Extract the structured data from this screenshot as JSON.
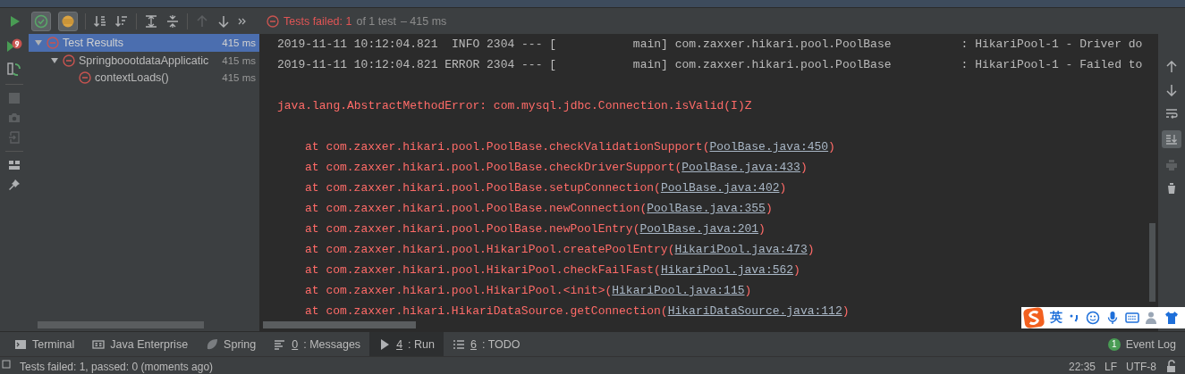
{
  "run_toolbar": {
    "toggles": [
      {
        "kind": "passed",
        "selected": true
      },
      {
        "kind": "ignored",
        "selected": true
      }
    ]
  },
  "status_header": {
    "failed": "Tests failed: 1",
    "rest": "of 1 test",
    "duration": "– 415 ms"
  },
  "tree": [
    {
      "label": "Test Results",
      "time": "415 ms",
      "expanded": true,
      "selected": true,
      "children": [
        {
          "label": "SpringboootdataApplicatic",
          "time": "415 ms",
          "expanded": true,
          "selected": false,
          "children": [
            {
              "label": "contextLoads()",
              "time": "415 ms",
              "selected": false
            }
          ]
        }
      ]
    }
  ],
  "console": {
    "lines": [
      {
        "kind": "log",
        "text": "2019-11-11 10:12:04.821  INFO 2304 --- [           main] com.zaxxer.hikari.pool.PoolBase          : HikariPool-1 - Driver do"
      },
      {
        "kind": "log",
        "text": "2019-11-11 10:12:04.821 ERROR 2304 --- [           main] com.zaxxer.hikari.pool.PoolBase          : HikariPool-1 - Failed to"
      },
      {
        "kind": "blank"
      },
      {
        "kind": "error",
        "text": "java.lang.AbstractMethodError: com.mysql.jdbc.Connection.isValid(I)Z"
      },
      {
        "kind": "blank"
      },
      {
        "kind": "frame",
        "call": "at com.zaxxer.hikari.pool.PoolBase.checkValidationSupport(",
        "link": "PoolBase.java:450",
        "close": ")"
      },
      {
        "kind": "frame",
        "call": "at com.zaxxer.hikari.pool.PoolBase.checkDriverSupport(",
        "link": "PoolBase.java:433",
        "close": ")"
      },
      {
        "kind": "frame",
        "call": "at com.zaxxer.hikari.pool.PoolBase.setupConnection(",
        "link": "PoolBase.java:402",
        "close": ")"
      },
      {
        "kind": "frame",
        "call": "at com.zaxxer.hikari.pool.PoolBase.newConnection(",
        "link": "PoolBase.java:355",
        "close": ")"
      },
      {
        "kind": "frame",
        "call": "at com.zaxxer.hikari.pool.PoolBase.newPoolEntry(",
        "link": "PoolBase.java:201",
        "close": ")"
      },
      {
        "kind": "frame",
        "call": "at com.zaxxer.hikari.pool.HikariPool.createPoolEntry(",
        "link": "HikariPool.java:473",
        "close": ")"
      },
      {
        "kind": "frame",
        "call": "at com.zaxxer.hikari.pool.HikariPool.checkFailFast(",
        "link": "HikariPool.java:562",
        "close": ")"
      },
      {
        "kind": "frame",
        "call": "at com.zaxxer.hikari.pool.HikariPool.<init>(",
        "link": "HikariPool.java:115",
        "close": ")"
      },
      {
        "kind": "frame",
        "call": "at com.zaxxer.hikari.HikariDataSource.getConnection(",
        "link": "HikariDataSource.java:112",
        "close": ")"
      }
    ]
  },
  "tool_windows": [
    {
      "kind": "terminal",
      "label": "Terminal",
      "selected": false
    },
    {
      "kind": "javaee",
      "label": "Java Enterprise",
      "selected": false
    },
    {
      "kind": "spring",
      "label": "Spring",
      "selected": false
    },
    {
      "kind": "messages",
      "mnemonic": "0",
      "label": ": Messages",
      "selected": false
    },
    {
      "kind": "run",
      "mnemonic": "4",
      "label": ": Run",
      "selected": true
    },
    {
      "kind": "todo",
      "mnemonic": "6",
      "label": ": TODO",
      "selected": false
    }
  ],
  "event_log": {
    "count": "1",
    "label": "Event Log"
  },
  "status_bar": {
    "message": "Tests failed: 1, passed: 0 (moments ago)",
    "position": "22:35",
    "line_separator": "LF",
    "encoding": "UTF-8"
  },
  "ime_bar": {
    "mode": "英"
  }
}
